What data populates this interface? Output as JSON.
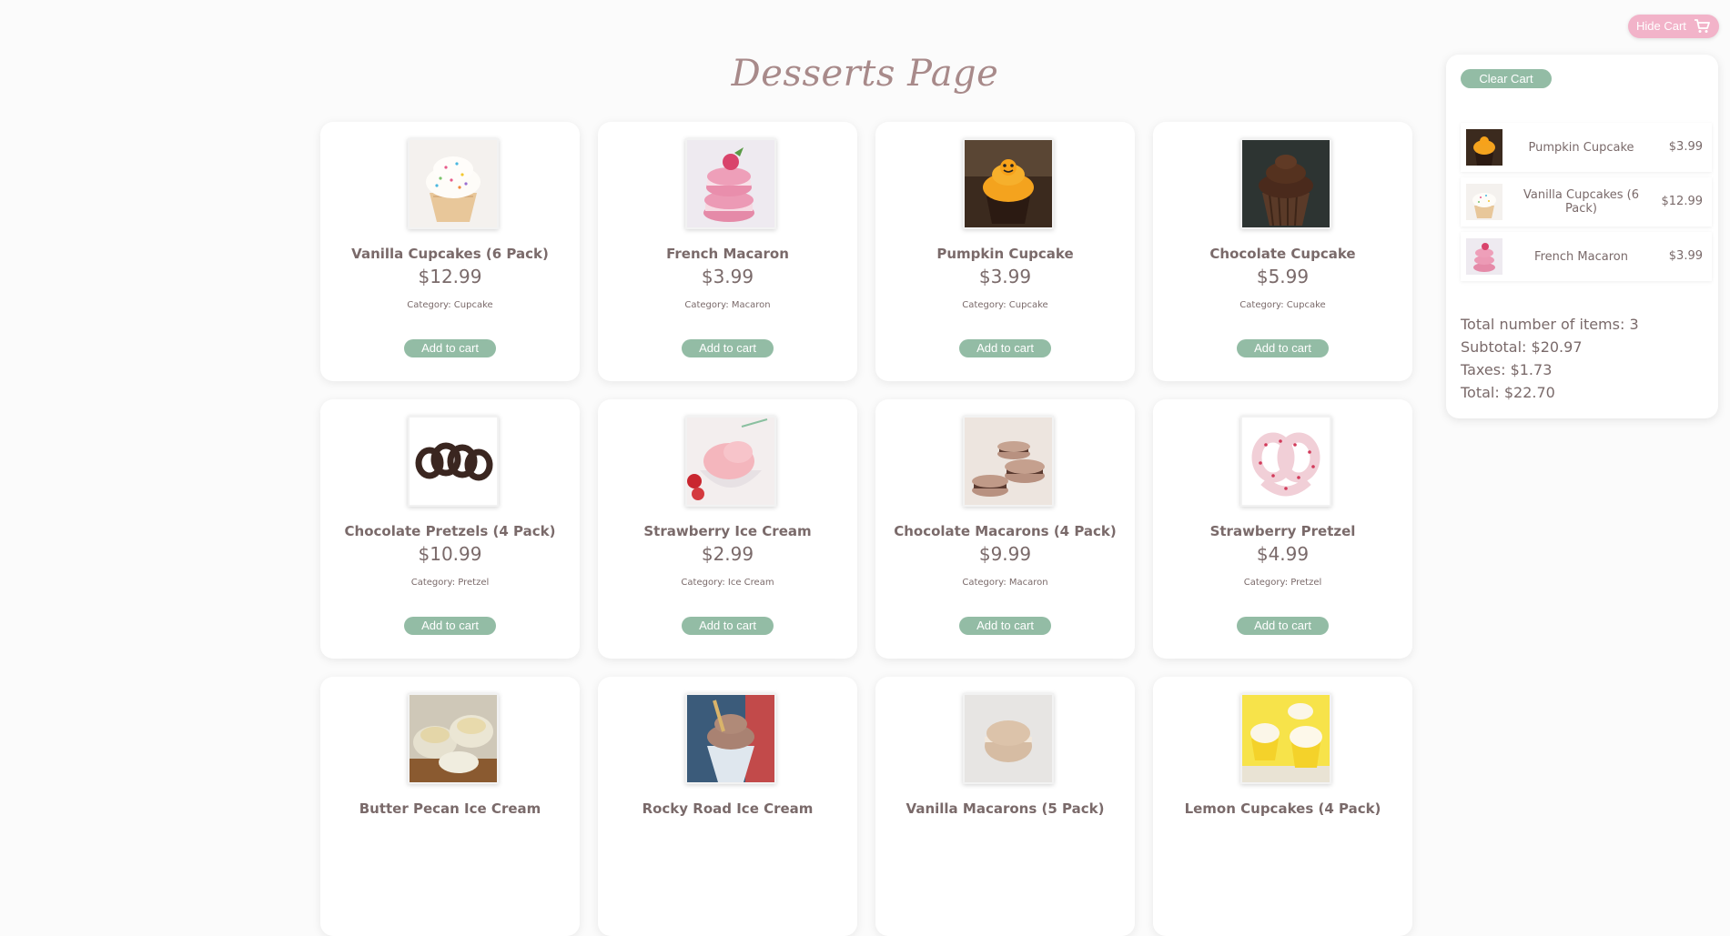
{
  "page": {
    "title": "Desserts Page"
  },
  "products": [
    {
      "name": "Vanilla Cupcakes (6 Pack)",
      "price": "$12.99",
      "category": "Category: Cupcake",
      "button": "Add to cart",
      "image": "vanilla-cupcake-image"
    },
    {
      "name": "French Macaron",
      "price": "$3.99",
      "category": "Category: Macaron",
      "button": "Add to cart",
      "image": "french-macaron-image"
    },
    {
      "name": "Pumpkin Cupcake",
      "price": "$3.99",
      "category": "Category: Cupcake",
      "button": "Add to cart",
      "image": "pumpkin-cupcake-image"
    },
    {
      "name": "Chocolate Cupcake",
      "price": "$5.99",
      "category": "Category: Cupcake",
      "button": "Add to cart",
      "image": "chocolate-cupcake-image"
    },
    {
      "name": "Chocolate Pretzels (4 Pack)",
      "price": "$10.99",
      "category": "Category: Pretzel",
      "button": "Add to cart",
      "image": "chocolate-pretzels-image"
    },
    {
      "name": "Strawberry Ice Cream",
      "price": "$2.99",
      "category": "Category: Ice Cream",
      "button": "Add to cart",
      "image": "strawberry-ice-cream-image"
    },
    {
      "name": "Chocolate Macarons (4 Pack)",
      "price": "$9.99",
      "category": "Category: Macaron",
      "button": "Add to cart",
      "image": "chocolate-macarons-image"
    },
    {
      "name": "Strawberry Pretzel",
      "price": "$4.99",
      "category": "Category: Pretzel",
      "button": "Add to cart",
      "image": "strawberry-pretzel-image"
    },
    {
      "name": "Butter Pecan Ice Cream",
      "image": "butter-pecan-ice-cream-image"
    },
    {
      "name": "Rocky Road Ice Cream",
      "image": "rocky-road-ice-cream-image"
    },
    {
      "name": "Vanilla Macarons (5 Pack)",
      "image": "vanilla-macarons-image"
    },
    {
      "name": "Lemon Cupcakes (4 Pack)",
      "image": "lemon-cupcakes-image"
    }
  ],
  "header": {
    "hide_cart": "Hide Cart",
    "cart_icon": "shopping-cart-icon"
  },
  "cart": {
    "clear_label": "Clear Cart",
    "items": [
      {
        "name": "Pumpkin Cupcake",
        "price": "$3.99"
      },
      {
        "name": "Vanilla Cupcakes (6 Pack)",
        "price": "$12.99"
      },
      {
        "name": "French Macaron",
        "price": "$3.99"
      }
    ],
    "total_items": "Total number of items: 3",
    "subtotal": "Subtotal: $20.97",
    "taxes": "Taxes: $1.73",
    "total": "Total: $22.70"
  },
  "colors": {
    "accent_green": "#93bca5",
    "accent_pink": "#f2b3c9",
    "text": "#7a6a6a",
    "title": "#a88a8a"
  }
}
